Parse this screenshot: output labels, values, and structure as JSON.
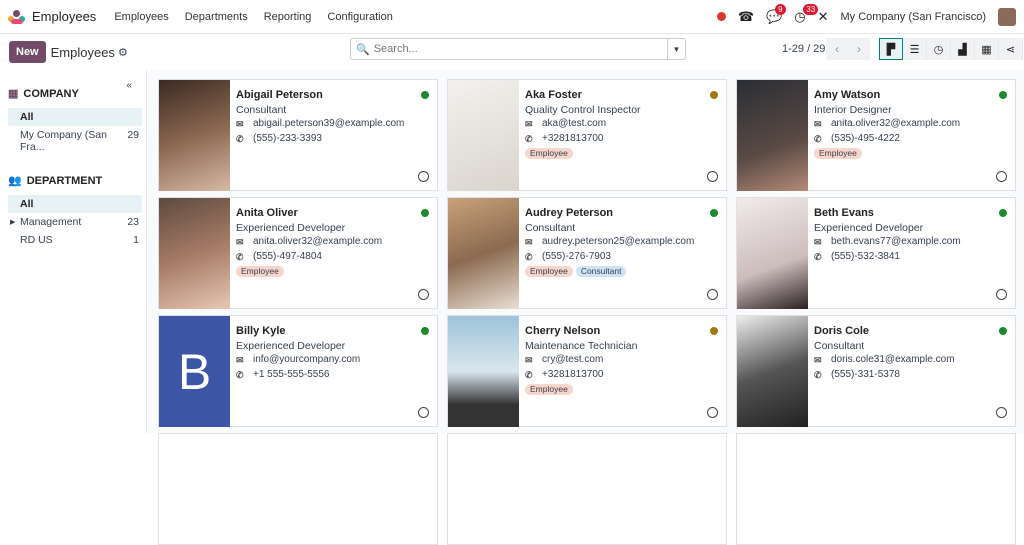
{
  "topbar": {
    "app_name": "Employees",
    "menu": [
      "Employees",
      "Departments",
      "Reporting",
      "Configuration"
    ],
    "messages_count": "9",
    "activities_count": "33",
    "company": "My Company (San Francisco)"
  },
  "control": {
    "new_label": "New",
    "title": "Employees",
    "search_placeholder": "Search...",
    "pager": "1-29 / 29"
  },
  "sidebar": {
    "company_header": "COMPANY",
    "company_items": [
      {
        "label": "All",
        "count": ""
      },
      {
        "label": "My Company (San Fra...",
        "count": "29"
      }
    ],
    "department_header": "DEPARTMENT",
    "department_items": [
      {
        "label": "All",
        "count": ""
      },
      {
        "label": "Management",
        "count": "23"
      },
      {
        "label": "RD US",
        "count": "1"
      }
    ]
  },
  "colors": {
    "brand": "#714b67",
    "online": "#1c8a2e",
    "away": "#a3770e",
    "employee_tag": "#f7d6cc",
    "consultant_tag": "#cfe3f7"
  },
  "employees": [
    {
      "name": "Abigail Peterson",
      "job": "Consultant",
      "email": "abigail.peterson39@example.com",
      "phone": "(555)-233-3393",
      "tags": [],
      "status": "online"
    },
    {
      "name": "Aka Foster",
      "job": "Quality Control Inspector",
      "email": "aka@test.com",
      "phone": "+3281813700",
      "tags": [
        "Employee"
      ],
      "status": "away"
    },
    {
      "name": "Amy Watson",
      "job": "Interior Designer",
      "email": "anita.oliver32@example.com",
      "phone": "(535)-495-4222",
      "tags": [
        "Employee"
      ],
      "status": "online"
    },
    {
      "name": "Anita Oliver",
      "job": "Experienced Developer",
      "email": "anita.oliver32@example.com",
      "phone": "(555)-497-4804",
      "tags": [
        "Employee"
      ],
      "status": "online"
    },
    {
      "name": "Audrey Peterson",
      "job": "Consultant",
      "email": "audrey.peterson25@example.com",
      "phone": "(555)-276-7903",
      "tags": [
        "Employee",
        "Consultant"
      ],
      "status": "online"
    },
    {
      "name": "Beth Evans",
      "job": "Experienced Developer",
      "email": "beth.evans77@example.com",
      "phone": "(555)-532-3841",
      "tags": [],
      "status": "online"
    },
    {
      "name": "Billy Kyle",
      "job": "Experienced Developer",
      "email": "info@yourcompany.com",
      "phone": "+1 555-555-5556",
      "tags": [],
      "status": "online",
      "initial": "B"
    },
    {
      "name": "Cherry Nelson",
      "job": "Maintenance Technician",
      "email": "cry@test.com",
      "phone": "+3281813700",
      "tags": [
        "Employee"
      ],
      "status": "away"
    },
    {
      "name": "Doris Cole",
      "job": "Consultant",
      "email": "doris.cole31@example.com",
      "phone": "(555)-331-5378",
      "tags": [],
      "status": "online"
    }
  ]
}
